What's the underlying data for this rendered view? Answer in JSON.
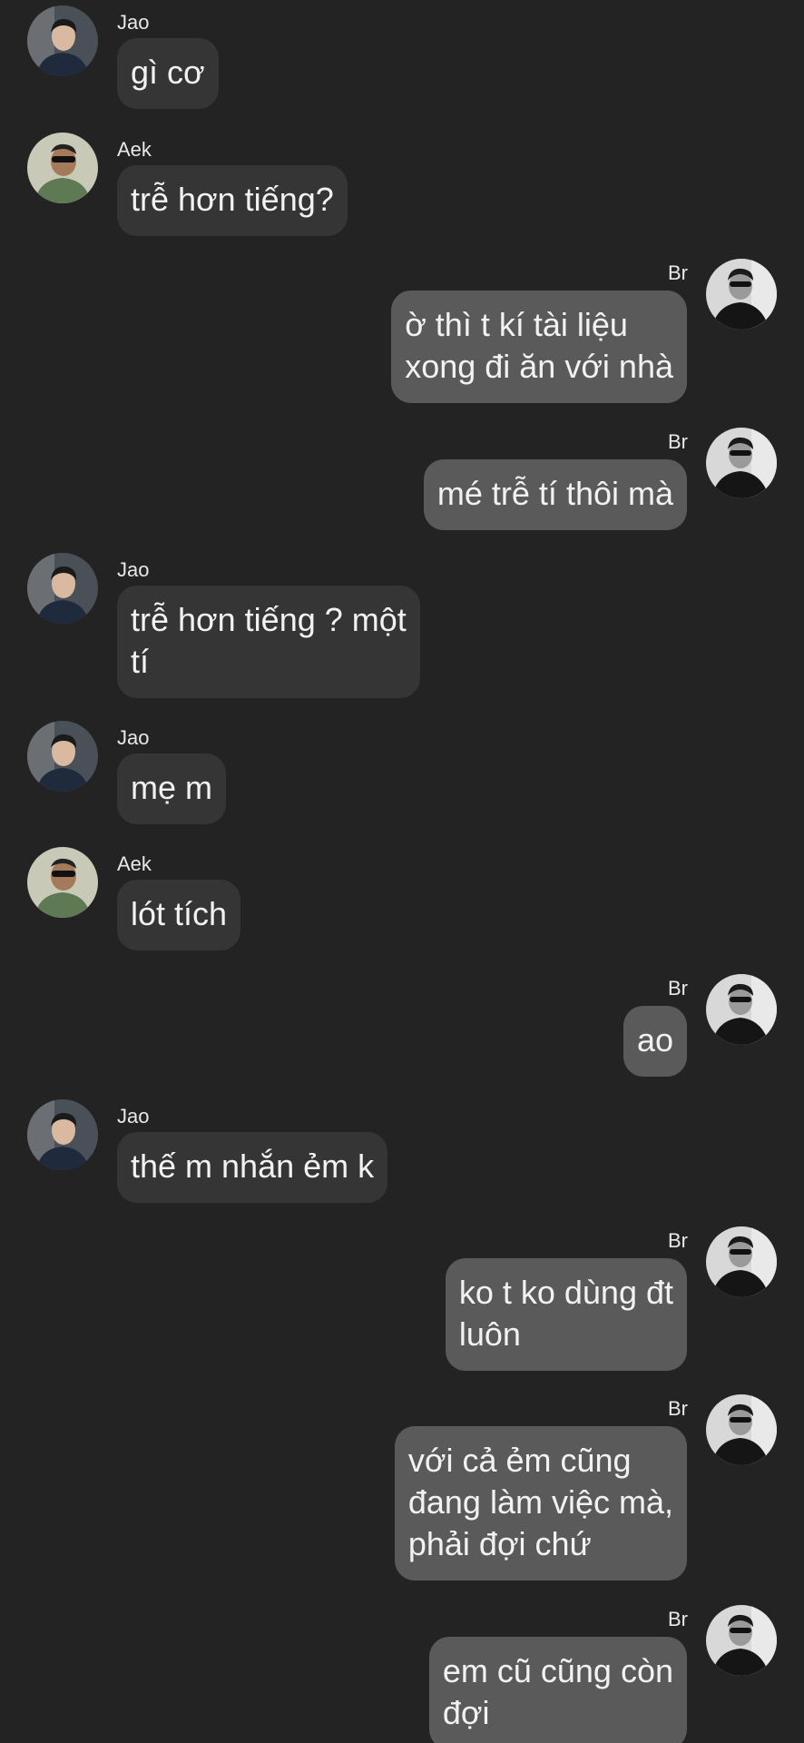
{
  "messages": [
    {
      "side": "left",
      "sender": "Jao",
      "avatar": "jao",
      "text": "gì cơ"
    },
    {
      "side": "left",
      "sender": "Aek",
      "avatar": "aek",
      "text": "trễ hơn tiếng?"
    },
    {
      "side": "right",
      "sender": "Br",
      "avatar": "br",
      "text": "ờ thì t kí tài liệu\nxong đi ăn với nhà"
    },
    {
      "side": "right",
      "sender": "Br",
      "avatar": "br",
      "text": "mé trễ tí thôi mà"
    },
    {
      "side": "left",
      "sender": "Jao",
      "avatar": "jao",
      "text": "trễ hơn tiếng ? một\ntí"
    },
    {
      "side": "left",
      "sender": "Jao",
      "avatar": "jao",
      "text": "mẹ m"
    },
    {
      "side": "left",
      "sender": "Aek",
      "avatar": "aek",
      "text": "lót tích"
    },
    {
      "side": "right",
      "sender": "Br",
      "avatar": "br",
      "text": "ao"
    },
    {
      "side": "left",
      "sender": "Jao",
      "avatar": "jao",
      "text": "thế m nhắn ẻm k"
    },
    {
      "side": "right",
      "sender": "Br",
      "avatar": "br",
      "text": "ko t ko dùng đt\nluôn"
    },
    {
      "side": "right",
      "sender": "Br",
      "avatar": "br",
      "text": "với cả ẻm cũng\nđang làm việc mà,\nphải đợi chứ"
    },
    {
      "side": "right",
      "sender": "Br",
      "avatar": "br",
      "text": "em cũ cũng còn\nđợi"
    }
  ]
}
